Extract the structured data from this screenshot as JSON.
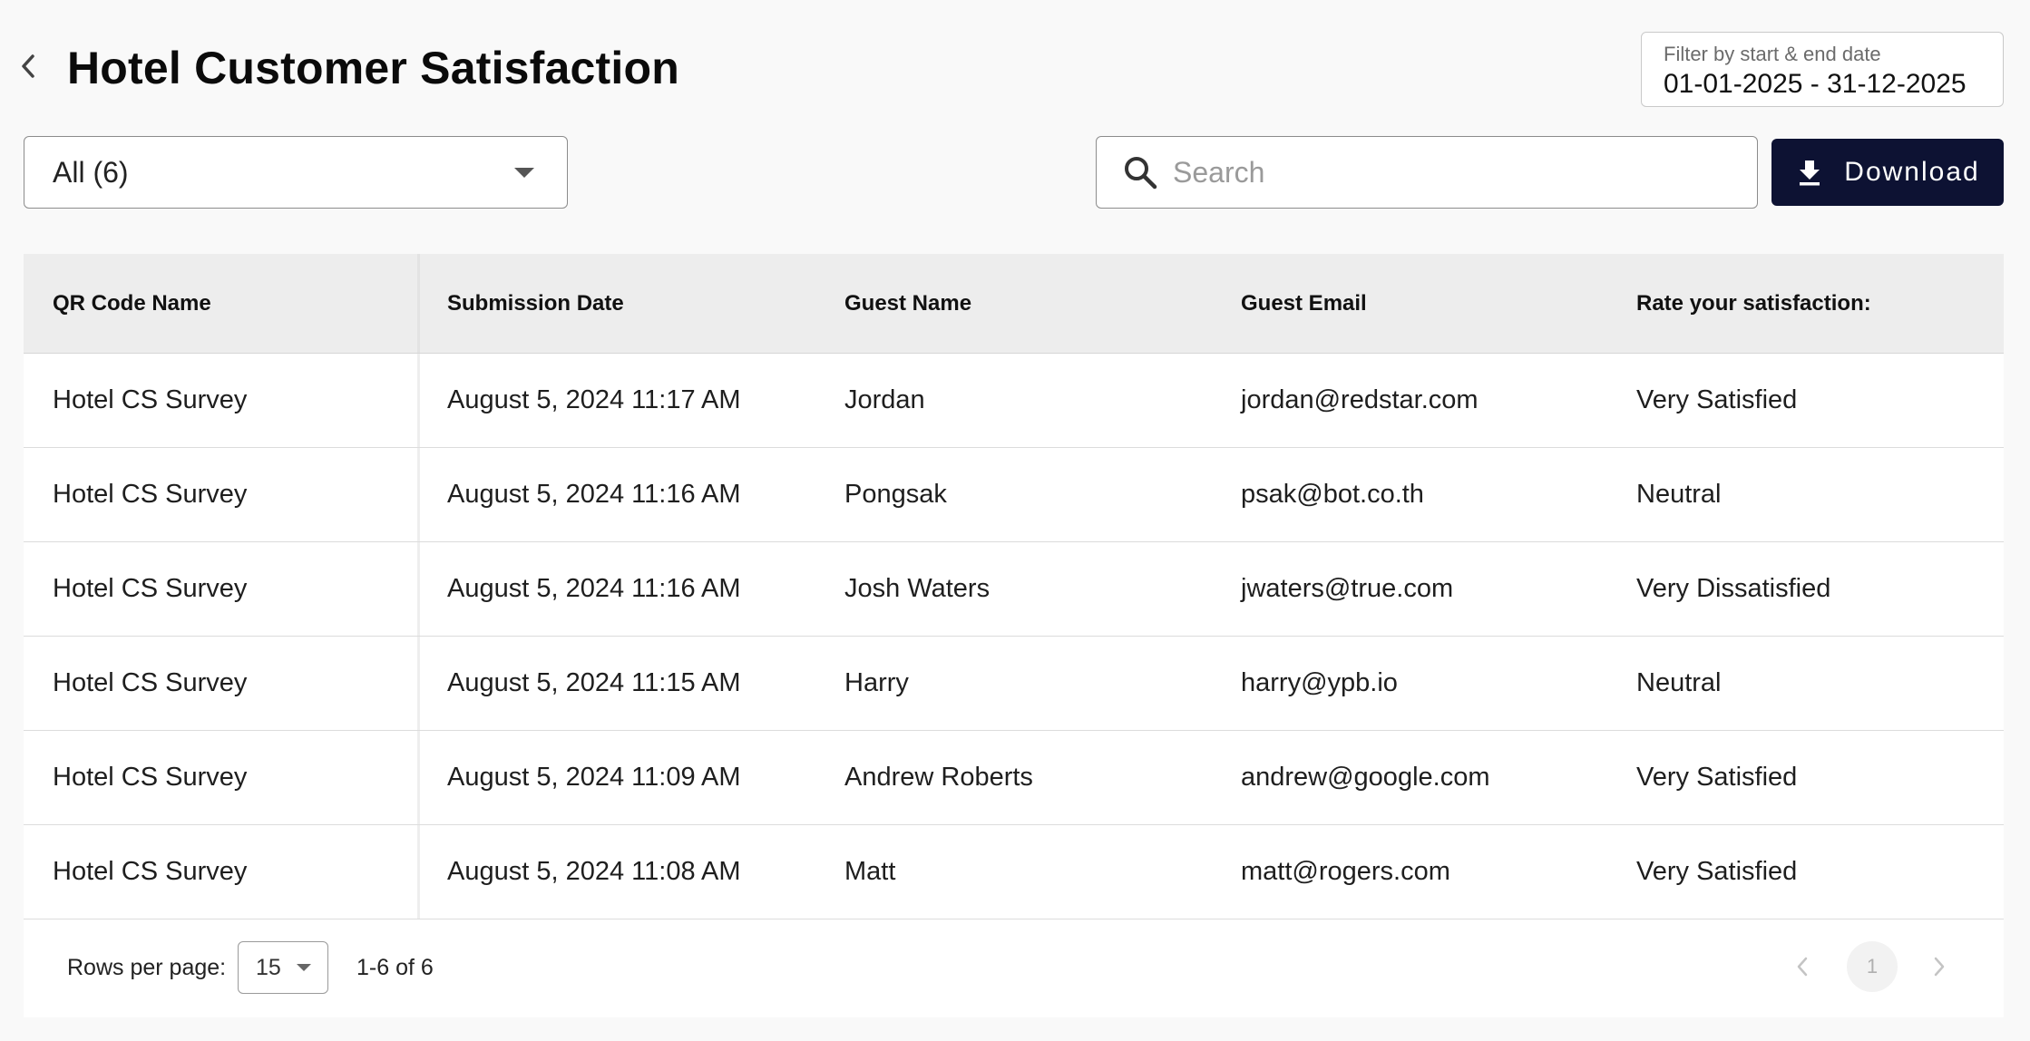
{
  "header": {
    "title": "Hotel Customer Satisfaction",
    "back_icon": "chevron-left-icon"
  },
  "date_filter": {
    "label": "Filter by start & end date",
    "value": "01-01-2025 - 31-12-2025"
  },
  "qr_filter": {
    "selected": "All (6)"
  },
  "search": {
    "placeholder": "Search",
    "value": ""
  },
  "download": {
    "label": "Download",
    "icon": "download-icon",
    "bg_color": "#0d1233"
  },
  "table": {
    "columns": [
      "QR Code Name",
      "Submission Date",
      "Guest Name",
      "Guest Email",
      "Rate your satisfaction:"
    ],
    "rows": [
      [
        "Hotel CS Survey",
        "August 5, 2024 11:17 AM",
        "Jordan",
        "jordan@redstar.com",
        "Very Satisfied"
      ],
      [
        "Hotel CS Survey",
        "August 5, 2024 11:16 AM",
        "Pongsak",
        "psak@bot.co.th",
        "Neutral"
      ],
      [
        "Hotel CS Survey",
        "August 5, 2024 11:16 AM",
        "Josh Waters",
        "jwaters@true.com",
        "Very Dissatisfied"
      ],
      [
        "Hotel CS Survey",
        "August 5, 2024 11:15 AM",
        "Harry",
        "harry@ypb.io",
        "Neutral"
      ],
      [
        "Hotel CS Survey",
        "August 5, 2024 11:09 AM",
        "Andrew Roberts",
        "andrew@google.com",
        "Very Satisfied"
      ],
      [
        "Hotel CS Survey",
        "August 5, 2024 11:08 AM",
        "Matt",
        "matt@rogers.com",
        "Very Satisfied"
      ]
    ]
  },
  "pagination": {
    "rows_per_page_label": "Rows per page:",
    "rows_per_page_value": "15",
    "range_text": "1-6 of 6",
    "current_page": "1"
  }
}
